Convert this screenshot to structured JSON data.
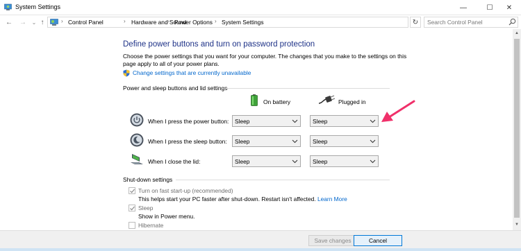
{
  "window": {
    "title": "System Settings",
    "minimize": "—",
    "maximize": "☐",
    "close": "✕"
  },
  "nav": {
    "back": "←",
    "forward": "→",
    "recent": "⌄",
    "up": "↑",
    "breadcrumbs": [
      "Control Panel",
      "Hardware and Sound",
      "Power Options",
      "System Settings"
    ],
    "separator": "›",
    "refresh": "↻",
    "search_placeholder": "Search Control Panel"
  },
  "content": {
    "heading": "Define power buttons and turn on password protection",
    "description": "Choose the power settings that you want for your computer. The changes that you make to the settings on this page apply to all of your power plans.",
    "change_link": "Change settings that are currently unavailable",
    "power_section": {
      "title": "Power and sleep buttons and lid settings",
      "columns": [
        "On battery",
        "Plugged in"
      ],
      "rows": [
        {
          "label": "When I press the power button:",
          "on_battery": "Sleep",
          "plugged_in": "Sleep",
          "icon": "power-button-icon"
        },
        {
          "label": "When I press the sleep button:",
          "on_battery": "Sleep",
          "plugged_in": "Sleep",
          "icon": "sleep-button-icon"
        },
        {
          "label": "When I close the lid:",
          "on_battery": "Sleep",
          "plugged_in": "Sleep",
          "icon": "laptop-lid-icon"
        }
      ]
    },
    "shutdown_section": {
      "title": "Shut-down settings",
      "items": [
        {
          "label": "Turn on fast start-up (recommended)",
          "checked": true,
          "description": "This helps start your PC faster after shut-down. Restart isn't affected.",
          "link": "Learn More"
        },
        {
          "label": "Sleep",
          "checked": true,
          "description": "Show in Power menu."
        },
        {
          "label": "Hibernate",
          "checked": false
        }
      ]
    }
  },
  "footer": {
    "save": "Save changes",
    "cancel": "Cancel"
  },
  "colors": {
    "heading": "#1e3287",
    "link": "#0066cc",
    "annotation_arrow": "#f0306a"
  }
}
